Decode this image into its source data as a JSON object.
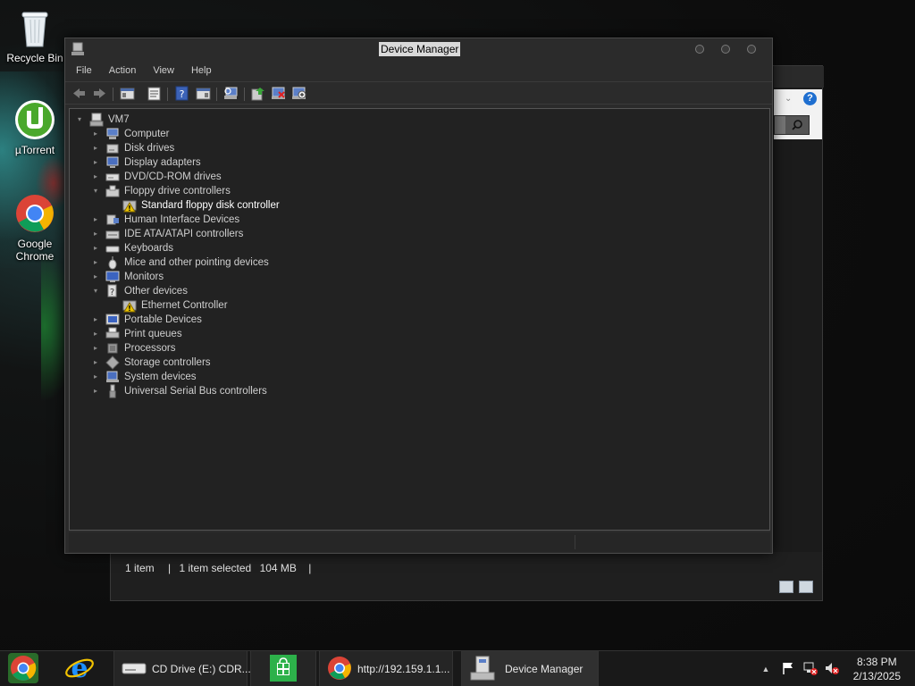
{
  "desktop": {
    "icons": [
      {
        "label": "Recycle Bin",
        "icon": "recycle-bin-icon"
      },
      {
        "label": "µTorrent",
        "icon": "utorrent-icon"
      },
      {
        "label": "Google Chrome",
        "icon": "chrome-icon"
      }
    ]
  },
  "background_window": {
    "status": {
      "items": "1 item",
      "selected": "1 item selected",
      "size": "104 MB",
      "separator": "|"
    }
  },
  "device_manager": {
    "title": "Device Manager",
    "menu": [
      "File",
      "Action",
      "View",
      "Help"
    ],
    "toolbar": [
      "back-icon",
      "forward-icon",
      "show-hide-console-tree-icon",
      "properties-icon",
      "help-icon",
      "action-pane-icon",
      "scan-hardware-icon",
      "update-driver-icon",
      "uninstall-icon",
      "enable-device-icon"
    ],
    "tree": {
      "root": "VM7",
      "categories": [
        {
          "label": "Computer",
          "expanded": false,
          "icon": "computer-icon"
        },
        {
          "label": "Disk drives",
          "expanded": false,
          "icon": "disk-drive-icon"
        },
        {
          "label": "Display adapters",
          "expanded": false,
          "icon": "display-adapter-icon"
        },
        {
          "label": "DVD/CD-ROM drives",
          "expanded": false,
          "icon": "dvd-drive-icon"
        },
        {
          "label": "Floppy drive controllers",
          "expanded": true,
          "icon": "floppy-controller-icon",
          "children": [
            {
              "label": "Standard floppy disk controller",
              "warning": true,
              "selected": true
            }
          ]
        },
        {
          "label": "Human Interface Devices",
          "expanded": false,
          "icon": "hid-icon"
        },
        {
          "label": "IDE ATA/ATAPI controllers",
          "expanded": false,
          "icon": "ide-controller-icon"
        },
        {
          "label": "Keyboards",
          "expanded": false,
          "icon": "keyboard-icon"
        },
        {
          "label": "Mice and other pointing devices",
          "expanded": false,
          "icon": "mouse-icon"
        },
        {
          "label": "Monitors",
          "expanded": false,
          "icon": "monitor-icon"
        },
        {
          "label": "Other devices",
          "expanded": true,
          "icon": "unknown-device-icon",
          "children": [
            {
              "label": "Ethernet Controller",
              "warning": true,
              "selected": false
            }
          ]
        },
        {
          "label": "Portable Devices",
          "expanded": false,
          "icon": "portable-device-icon"
        },
        {
          "label": "Print queues",
          "expanded": false,
          "icon": "printer-icon"
        },
        {
          "label": "Processors",
          "expanded": false,
          "icon": "processor-icon"
        },
        {
          "label": "Storage controllers",
          "expanded": false,
          "icon": "storage-controller-icon"
        },
        {
          "label": "System devices",
          "expanded": false,
          "icon": "system-device-icon"
        },
        {
          "label": "Universal Serial Bus controllers",
          "expanded": false,
          "icon": "usb-icon"
        }
      ]
    }
  },
  "taskbar": {
    "pinned": [
      "chrome-icon",
      "internet-explorer-icon"
    ],
    "tasks": [
      {
        "label": "CD Drive (E:) CDR...",
        "icon": "cd-drive-icon"
      },
      {
        "label": "",
        "icon": "store-icon"
      },
      {
        "label": "http://192.159.1.1...",
        "icon": "chrome-icon"
      },
      {
        "label": "Device Manager",
        "icon": "device-manager-icon",
        "active": true
      }
    ],
    "tray_icons": [
      "show-hidden-icons-arrow",
      "action-center-flag-icon",
      "network-disconnected-icon",
      "volume-muted-icon"
    ],
    "time": "8:38 PM",
    "date": "2/13/2025"
  },
  "colors": {
    "warning": "#e8c200",
    "window_bg": "#2b2b2b",
    "pane_bg": "#222222"
  }
}
